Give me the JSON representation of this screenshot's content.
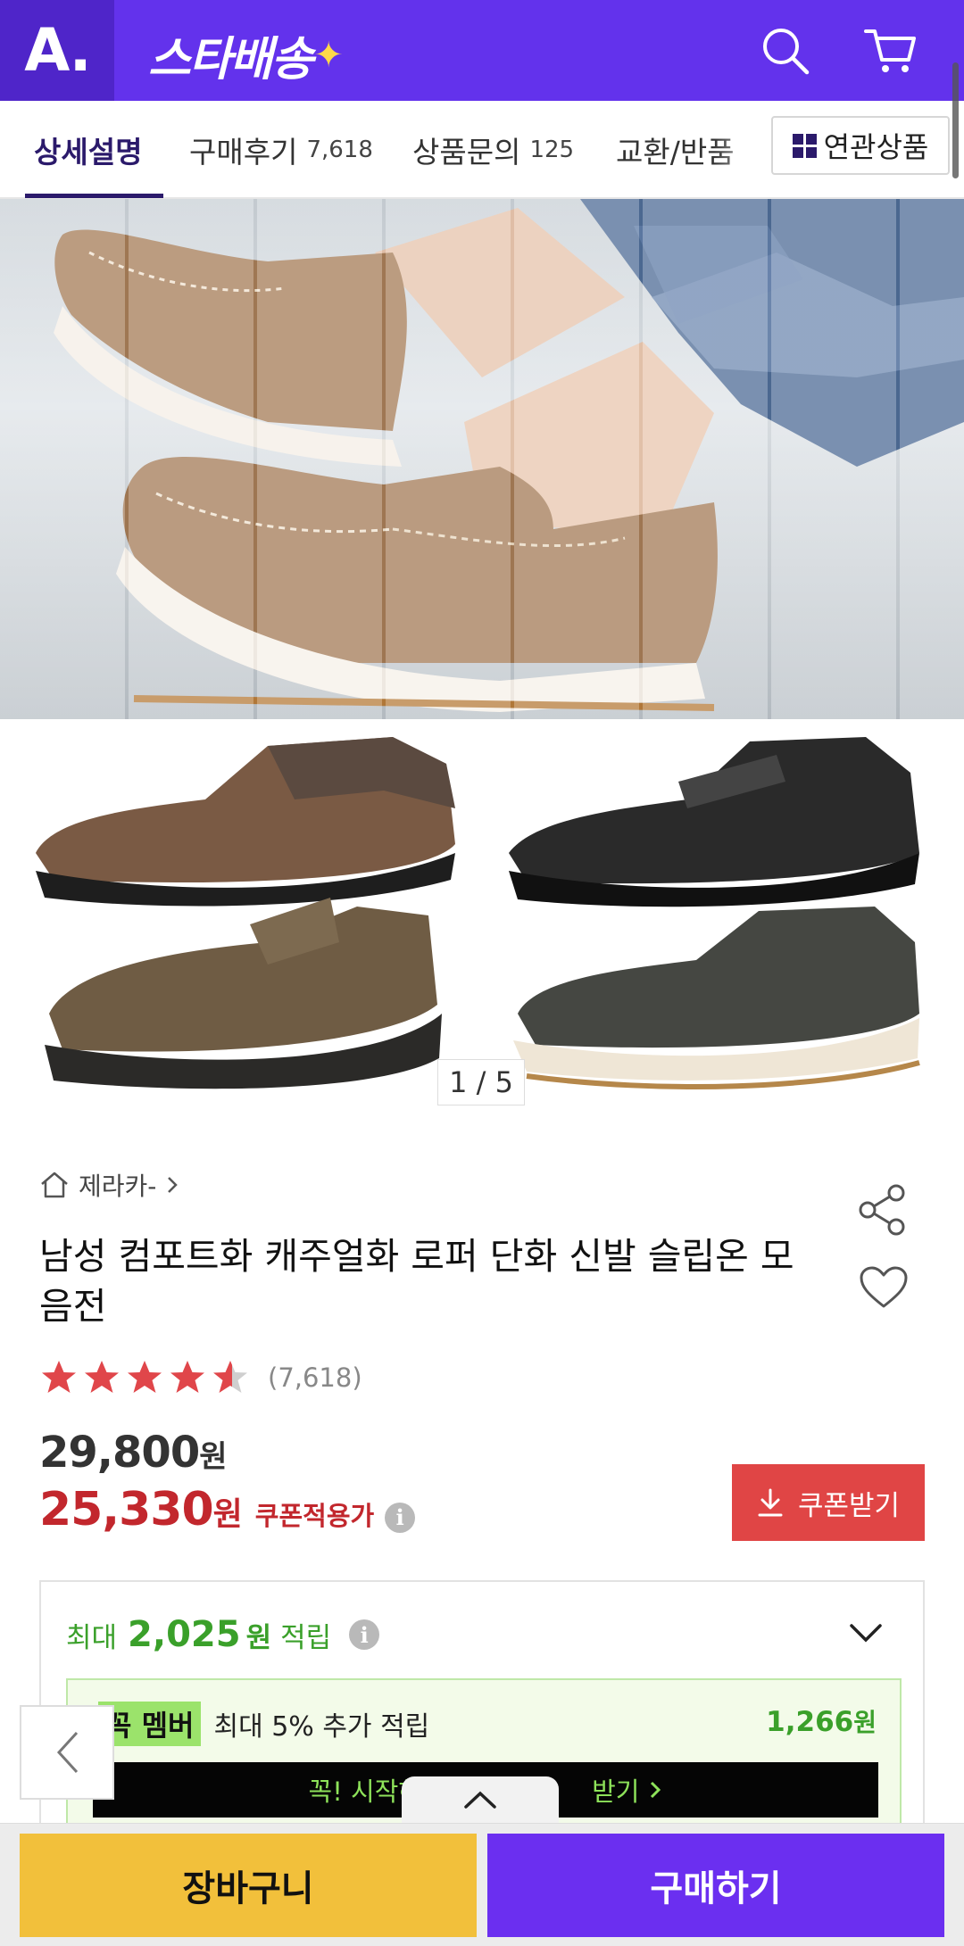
{
  "header": {
    "logo": "A.",
    "brand": "스타배송",
    "colors": {
      "header_bg": "#6332ec",
      "logo_bg": "#4f25c9"
    }
  },
  "tabs": [
    {
      "label": "상세설명",
      "count": ""
    },
    {
      "label": "구매후기",
      "count": "7,618"
    },
    {
      "label": "상품문의",
      "count": "125"
    },
    {
      "label": "교환/반품",
      "count": ""
    }
  ],
  "related_button": "연관상품",
  "gallery": {
    "counter": "1 / 5"
  },
  "product": {
    "store": "제라카-",
    "title": "남성 컴포트화 캐주얼화 로퍼 단화 신발 슬립온 모음전",
    "rating": 4.5,
    "review_count": "(7,618)",
    "price_original": "29,800",
    "price_sale": "25,330",
    "won": "원",
    "coupon_price_label": "쿠폰적용가",
    "coupon_button": "쿠폰받기"
  },
  "points": {
    "prefix": "최대",
    "amount": "2,025",
    "unit": "원",
    "suffix": "적립",
    "member_tag": "꼭 멤버",
    "member_text": "최대 5% 추가 적립",
    "member_amount": "1,266",
    "member_bar_left": "꼭! 시작하",
    "member_bar_right": "받기"
  },
  "bottom": {
    "cart": "장바구니",
    "buy": "구매하기"
  },
  "colors": {
    "sale_red": "#c2272d",
    "green": "#3aa02a",
    "cart_yellow": "#f2c03b",
    "buy_purple": "#6b2ff0"
  },
  "icons": [
    "search-icon",
    "cart-icon",
    "home-icon",
    "share-icon",
    "heart-icon",
    "info-icon",
    "download-icon",
    "chevron-down-icon",
    "chevron-left-icon",
    "chevron-up-icon"
  ]
}
